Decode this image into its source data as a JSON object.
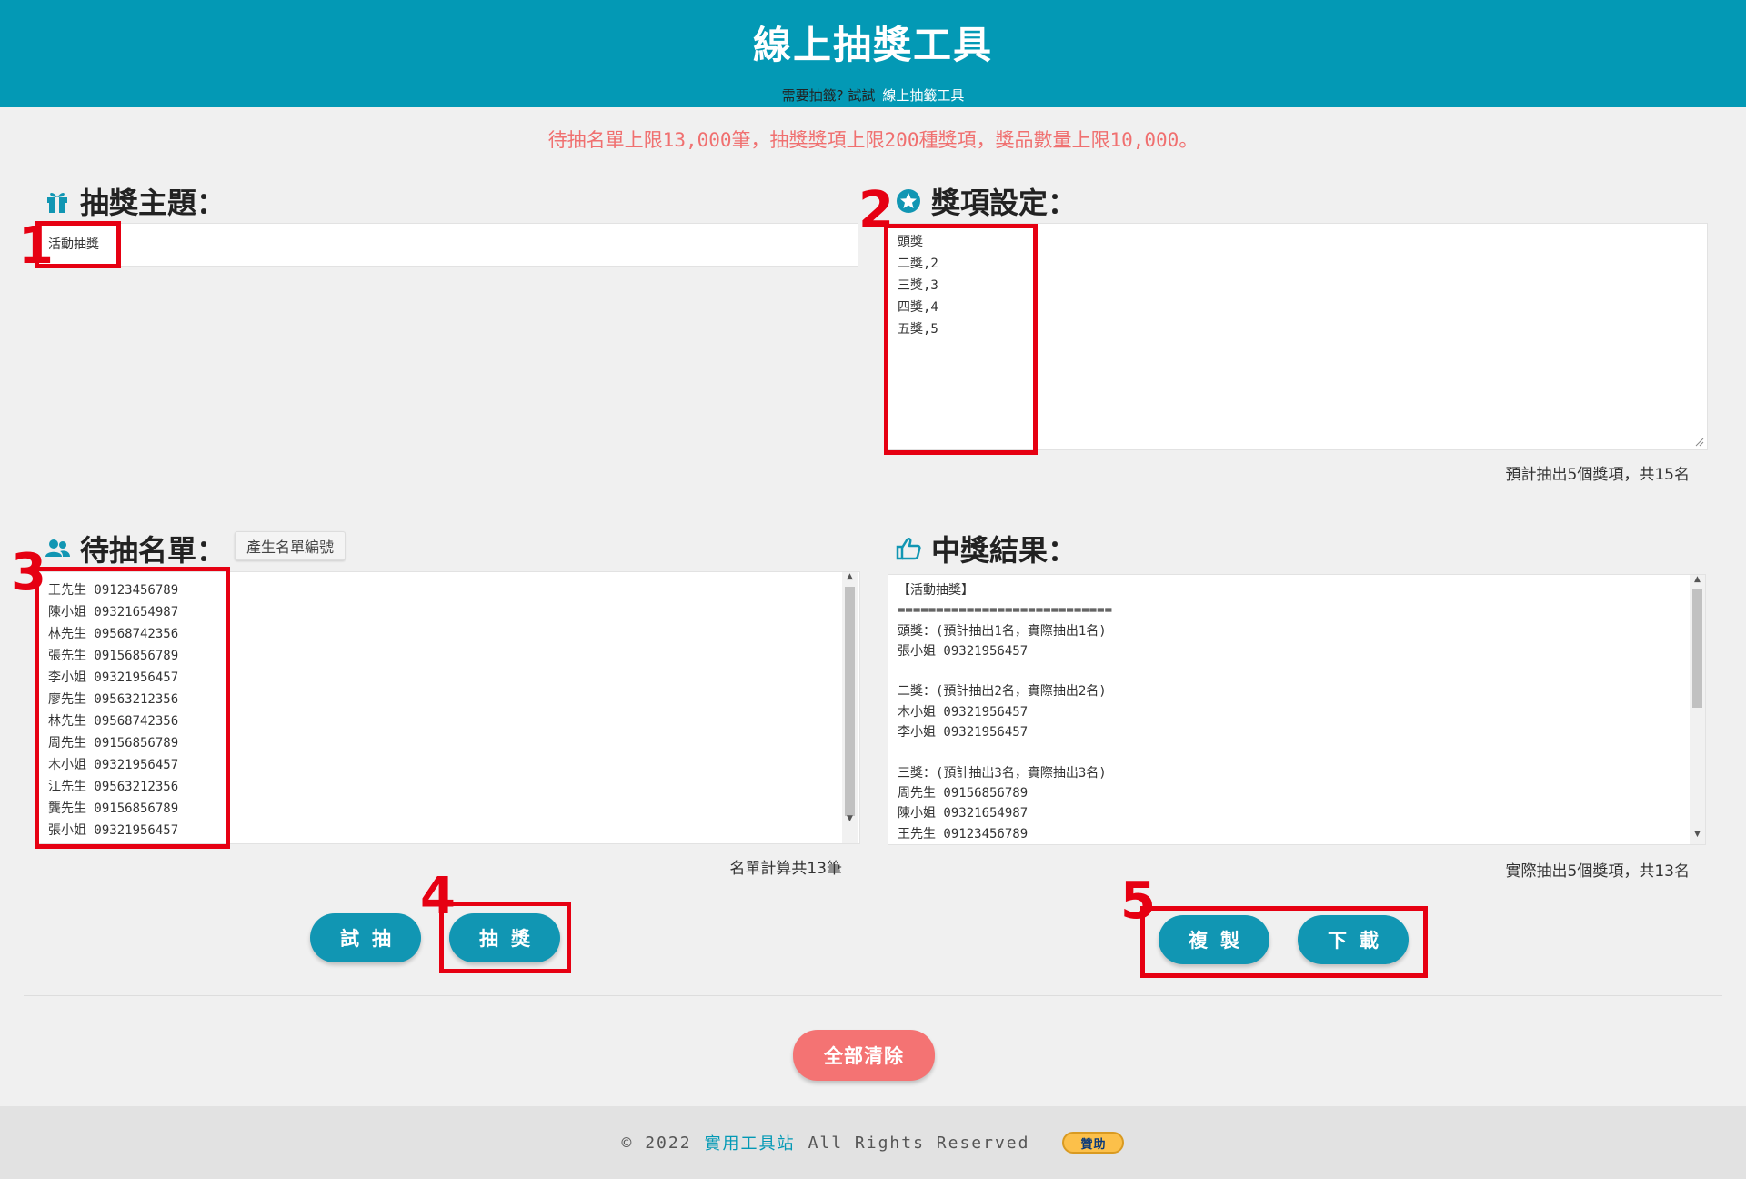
{
  "header": {
    "title": "線上抽獎工具",
    "subtitle_prefix": "需要抽籤? 試試",
    "subtitle_link": "線上抽籤工具"
  },
  "notice": {
    "text_1": "待抽名單上限",
    "num_1": "13,000",
    "text_2": "筆，抽獎獎項上限",
    "num_2": "200",
    "text_3": "種獎項，獎品數量上限",
    "num_3": "10,000",
    "text_4": "。"
  },
  "theme": {
    "title": "抽獎主題：",
    "value": "活動抽獎"
  },
  "prizes": {
    "title": "獎項設定：",
    "lines": [
      "頭獎",
      "二獎,2",
      "三獎,3",
      "四獎,4",
      "五獎,5"
    ],
    "summary": "預計抽出5個獎項，共15名"
  },
  "participants": {
    "title": "待抽名單：",
    "generate_button": "產生名單編號",
    "lines": [
      "王先生 09123456789",
      "陳小姐 09321654987",
      "林先生 09568742356",
      "張先生 09156856789",
      "李小姐 09321956457",
      "廖先生 09563212356",
      "林先生 09568742356",
      "周先生 09156856789",
      "木小姐 09321956457",
      "江先生 09563212356",
      "龔先生 09156856789",
      "張小姐 09321956457"
    ],
    "count": "名單計算共13筆"
  },
  "results": {
    "title": "中獎結果：",
    "lines": [
      "【活動抽獎】",
      "============================",
      "頭獎：(預計抽出1名，實際抽出1名)",
      "張小姐 09321956457",
      "",
      "二獎：(預計抽出2名，實際抽出2名)",
      "木小姐 09321956457",
      "李小姐 09321956457",
      "",
      "三獎：(預計抽出3名，實際抽出3名)",
      "周先生 09156856789",
      "陳小姐 09321654987",
      "王先生 09123456789"
    ],
    "summary": "實際抽出5個獎項，共13名"
  },
  "buttons": {
    "trial": "試抽",
    "draw": "抽獎",
    "copy": "複製",
    "download": "下載",
    "clear_all": "全部清除"
  },
  "markers": [
    "1",
    "2",
    "3",
    "4",
    "5"
  ],
  "footer": {
    "copyright": "© 2022",
    "site_name": "實用工具站",
    "rights": "All Rights Reserved",
    "donate": "贊助"
  },
  "colors": {
    "header_bg": "#0399b5",
    "accent": "#1196b3",
    "notice": "#f07070",
    "clear_button": "#f47373",
    "annotation": "#e60012"
  },
  "icons": {
    "theme": "gift-icon",
    "prizes": "star-circle-icon",
    "participants": "people-icon",
    "results": "thumbs-up-icon"
  }
}
